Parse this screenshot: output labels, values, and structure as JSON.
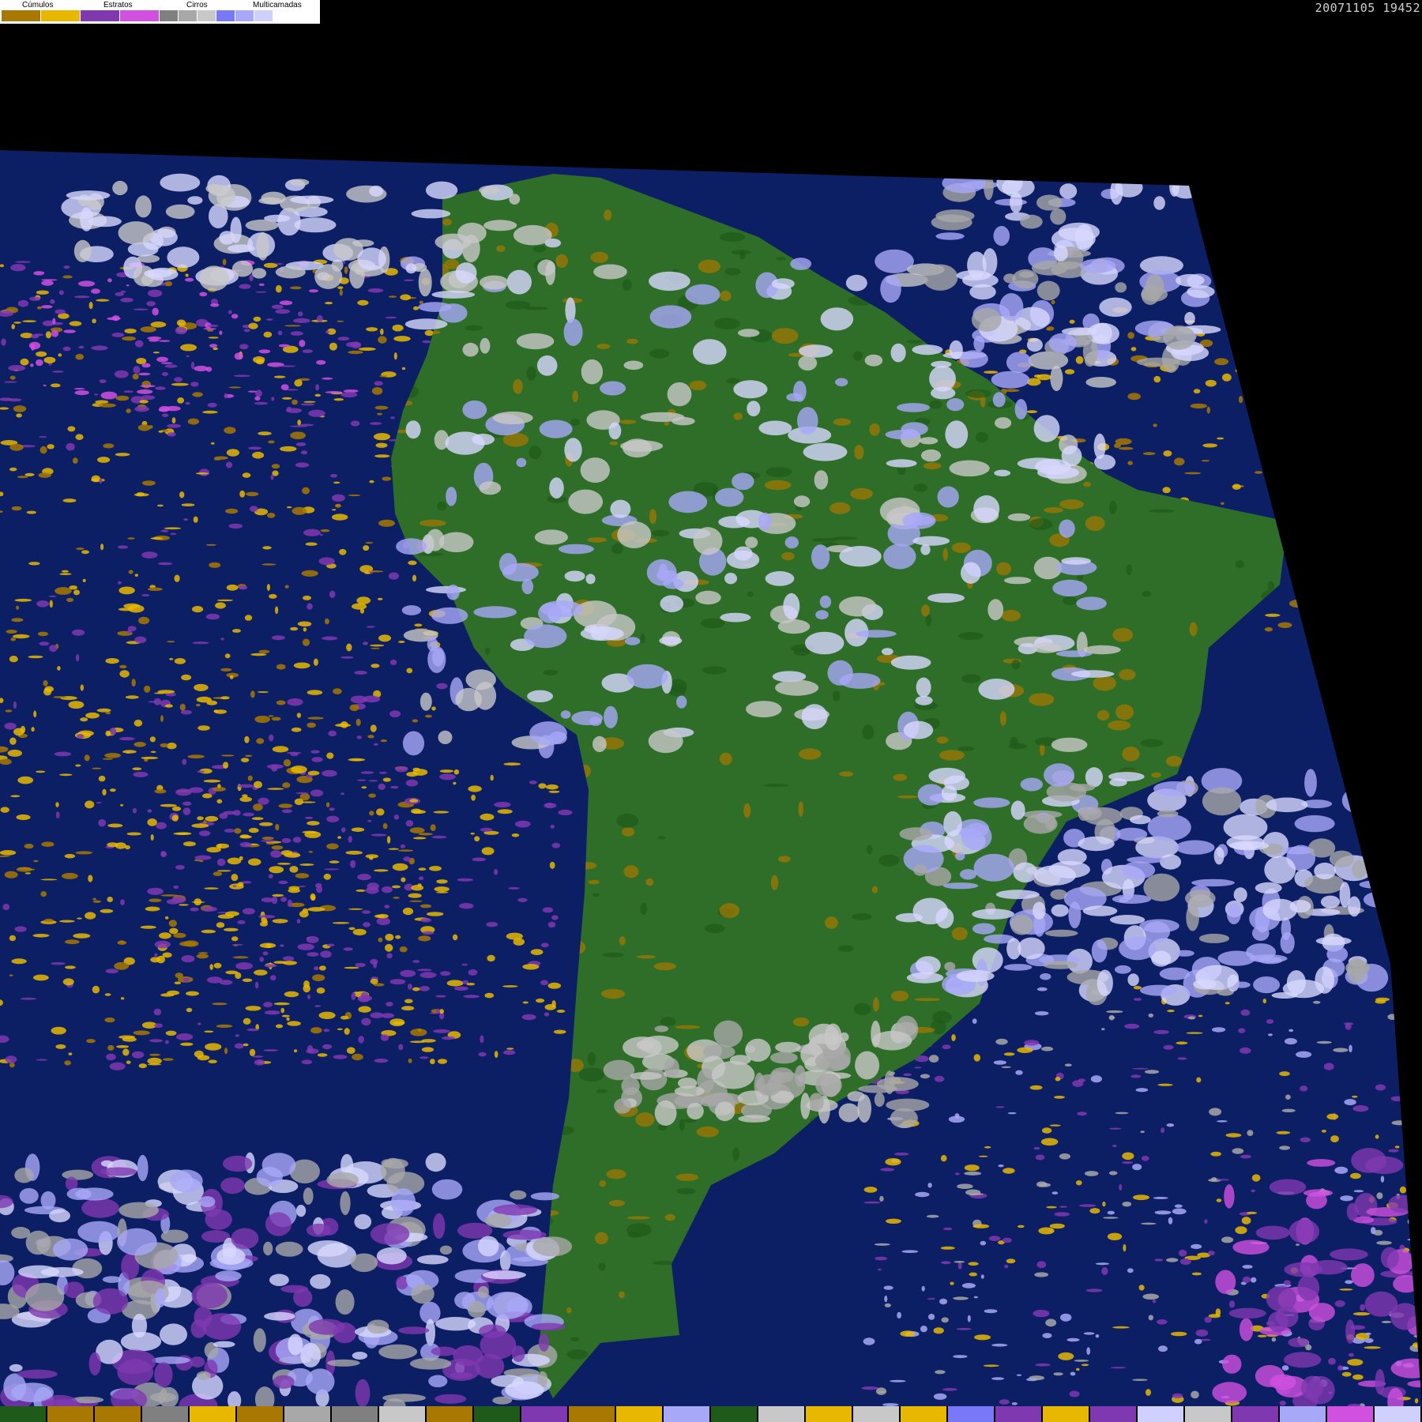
{
  "legend": {
    "categories": [
      {
        "label": "Cúmulos"
      },
      {
        "label": "Estratos"
      },
      {
        "label": "Cirros"
      },
      {
        "label": "Multicamadas"
      }
    ],
    "swatch_colors": [
      "#a87800",
      "#e8b800",
      "#8038b0",
      "#d050e0",
      "#808080",
      "#a8a8a8",
      "#c8c8c8",
      "#7878f8",
      "#a8a8f8",
      "#d0d0ff"
    ]
  },
  "timestamp": "20071105 19452",
  "map": {
    "colors": {
      "ocean": "#0c1e64",
      "land": "#2e6e28",
      "land_dark": "#1f5a1a",
      "cumulus_low": "#a87800",
      "cumulus": "#e8b800",
      "stratus": "#8038b0",
      "stratus_light": "#d050e0",
      "cirrus": "#a8a8a8",
      "cirrus_light": "#c8c8c8",
      "multilayer": "#a8a8f8",
      "multilayer_light": "#d8d8ff",
      "background": "#000000"
    }
  },
  "bottom_bar": {
    "colors": [
      "#1f5a1a",
      "#a87800",
      "#a87800",
      "#808080",
      "#e8b800",
      "#a87800",
      "#a8a8a8",
      "#808080",
      "#c8c8c8",
      "#a87800",
      "#1f5a1a",
      "#8038b0",
      "#a87800",
      "#e8b800",
      "#a8a8f8",
      "#1f5a1a",
      "#c8c8c8",
      "#e8b800",
      "#c8c8c8",
      "#e8b800",
      "#7878f8",
      "#8038b0",
      "#e8b800",
      "#8038b0",
      "#d0d0ff",
      "#c8c8c8",
      "#8038b0",
      "#a8a8f8",
      "#d050e0",
      "#d0d0ff"
    ]
  }
}
